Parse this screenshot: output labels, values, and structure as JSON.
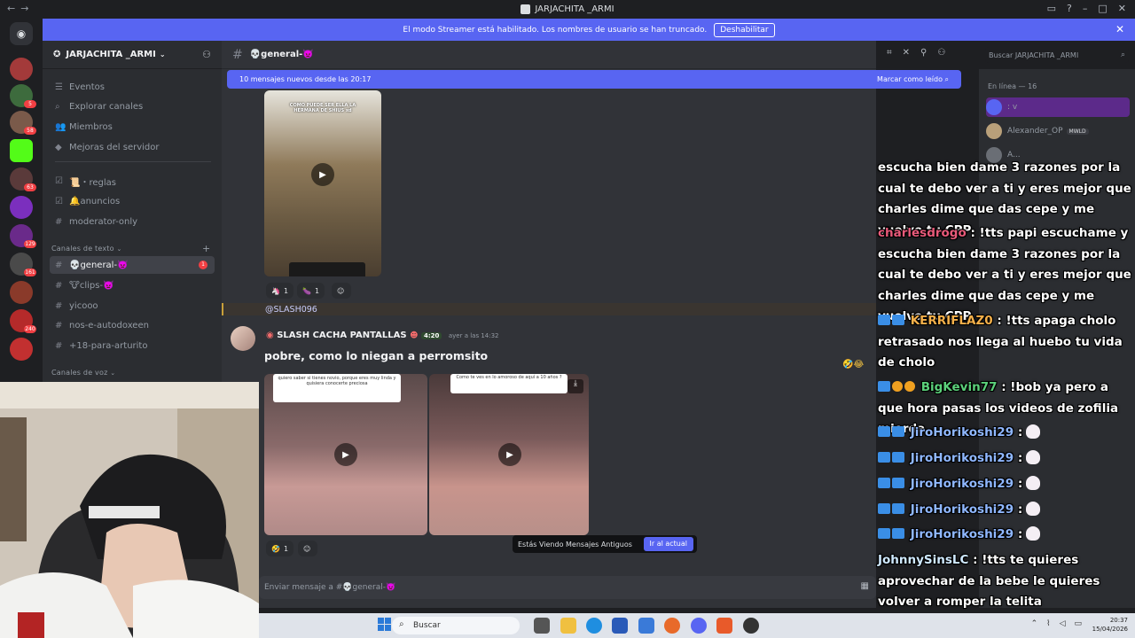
{
  "window": {
    "title": "JARJACHITA _ARMI",
    "nav_glyphs": "←→"
  },
  "streamer_bar": {
    "text": "El modo Streamer está habilitado. Los nombres de usuario se han truncado.",
    "button": "Deshabilitar"
  },
  "rail_badges": [
    "5",
    "58",
    "63",
    "129",
    "161",
    "240"
  ],
  "server": {
    "name": "JARJACHITA _ARMI",
    "items": [
      {
        "icon": "☰",
        "label": "Eventos"
      },
      {
        "icon": "⌕",
        "label": "Explorar canales"
      },
      {
        "icon": "👥",
        "label": "Miembros"
      },
      {
        "icon": "◆",
        "label": "Mejoras del servidor"
      }
    ],
    "channels_top": [
      {
        "icon": "☑",
        "label": "📜・reglas"
      },
      {
        "icon": "☑",
        "label": "🔔anuncios"
      },
      {
        "icon": "#",
        "label": "moderator-only"
      }
    ],
    "category_text": "Canales de texto",
    "text_channels": [
      {
        "label": "💀general-👿",
        "unread": "1"
      },
      {
        "label": "🐮clips-👿"
      },
      {
        "label": "yicooo"
      },
      {
        "label": "nos-e-autodoxeen"
      },
      {
        "label": "+18-para-arturito"
      }
    ],
    "category_voice": "Canales de voz"
  },
  "channel": {
    "name": "💀general-👿",
    "new_messages": "10 mensajes nuevos desde las 20:17",
    "mark_read": "Marcar como leído",
    "search_placeholder": "Buscar JARJACHITA _ARMI"
  },
  "messages": {
    "video1_caption": "COMO PUEDE SER ELLA LA HERMANA DE SHIUS xd",
    "reactions1": [
      {
        "emoji": "🦄",
        "count": "1"
      },
      {
        "emoji": "🍆",
        "count": "1"
      }
    ],
    "mention": "@SLASH096",
    "author": "SLASH CACHA PANTALLAS",
    "author_tag": "4:20",
    "timestamp": "ayer a las 14:32",
    "text": "pobre,   como lo niegan a perromsito",
    "video2_caption": "quiero saber si tienes novio, porque eres muy linda y quisiera conocerte preciosa",
    "video3_caption": "Como te ves en lo amoroso de aquí a 10 años ?",
    "reactions2": [
      {
        "emoji": "🤣",
        "count": "1"
      }
    ]
  },
  "old_messages": {
    "label": "Estás Viendo Mensajes Antiguos",
    "jump": "Ir al actual"
  },
  "composer": {
    "placeholder": "Enviar mensaje a #💀general-👿"
  },
  "members": {
    "category": "En línea — 16",
    "list": [
      {
        "name": ": v",
        "color": "#5865f2"
      },
      {
        "name": "Alexander_OP",
        "tag": "MWLD",
        "color": "#b9a07a"
      },
      {
        "name": "A...",
        "color": "#6a6e75"
      }
    ]
  },
  "chat_overlay": [
    {
      "user": "",
      "text": "escucha bien dame 3 razones por la cual te debo ver a ti y eres mejor que charles dime que das cepe y me vuelvo tu CPP"
    },
    {
      "user": "charlesdrogo",
      "text": ": !tts papi escuchame y escucha bien dame 3 razones por la cual te debo ver a ti y eres mejor que charles dime que das cepe y me vuelvo tu CPP"
    },
    {
      "user": "KERRIFLAZ0",
      "text": ": !tts apaga cholo retrasado nos llega al huebo tu vida de cholo"
    },
    {
      "user": "BigKevin77",
      "text": ": !bob ya pero a que hora pasas los videos de zofilia mierda"
    },
    {
      "user": "JiroHorikoshi29",
      "text": ":"
    },
    {
      "user": "JiroHorikoshi29",
      "text": ":"
    },
    {
      "user": "JiroHorikoshi29",
      "text": ":"
    },
    {
      "user": "JiroHorikoshi29",
      "text": ":"
    },
    {
      "user": "JiroHorikoshi29",
      "text": ":"
    },
    {
      "user": "JohnnySinsLC",
      "text": ": !tts te quieres aprovechar de la bebe le quieres volver a romper la telita"
    }
  ],
  "taskbar": {
    "search": "Buscar",
    "time": "20:37",
    "date": "15/04/2026"
  },
  "colors": {
    "accent": "#5865f2",
    "danger": "#f23f43",
    "bg_dark": "#1e1f22",
    "sidebar": "#2b2d31",
    "chat": "#313338"
  }
}
